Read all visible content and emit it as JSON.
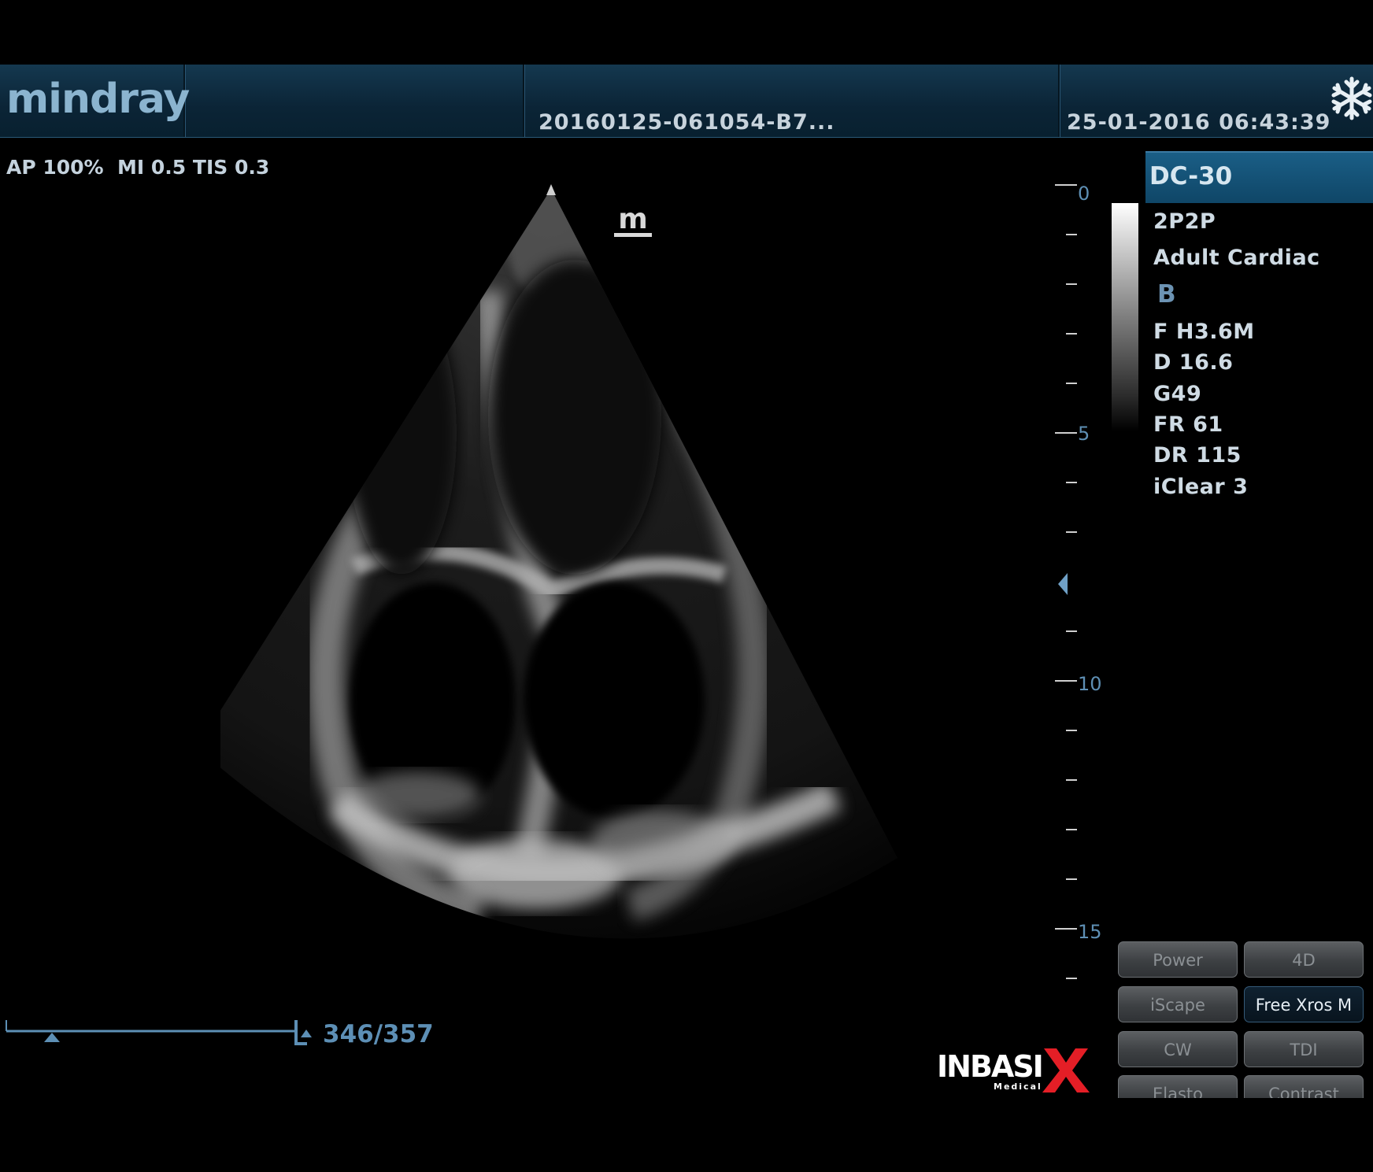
{
  "header": {
    "brand": "mindray",
    "exam_id": "20160125-061054-B7...",
    "datetime": "25-01-2016 06:43:39",
    "freeze_icon": "snowflake-icon"
  },
  "acoustic_output": "AP 100%  MI 0.5 TIS 0.3",
  "orientation_marker": "m",
  "depth_scale": {
    "labels": [
      "0",
      "5",
      "10",
      "15"
    ],
    "focus_marker_icon": "triangle-left-icon"
  },
  "params": {
    "probe": "DC-30",
    "preset_code": "2P2P",
    "exam_type": "Adult Cardiac",
    "mode": "B",
    "frequency": "F H3.6M",
    "depth": "D 16.6",
    "gain": "G49",
    "frame_rate": "FR 61",
    "dynamic_range": "DR 115",
    "iclear": "iClear 3"
  },
  "cine": {
    "frames": "346/357"
  },
  "watermark": {
    "text": "INBASIX",
    "subtext": "Medical"
  },
  "soft_buttons": [
    {
      "label": "Power"
    },
    {
      "label": "4D"
    },
    {
      "label": "iScape"
    },
    {
      "label": "Free Xros M"
    },
    {
      "label": "CW"
    },
    {
      "label": "TDI"
    },
    {
      "label": "Elasto"
    },
    {
      "label": "Contrast"
    }
  ]
}
